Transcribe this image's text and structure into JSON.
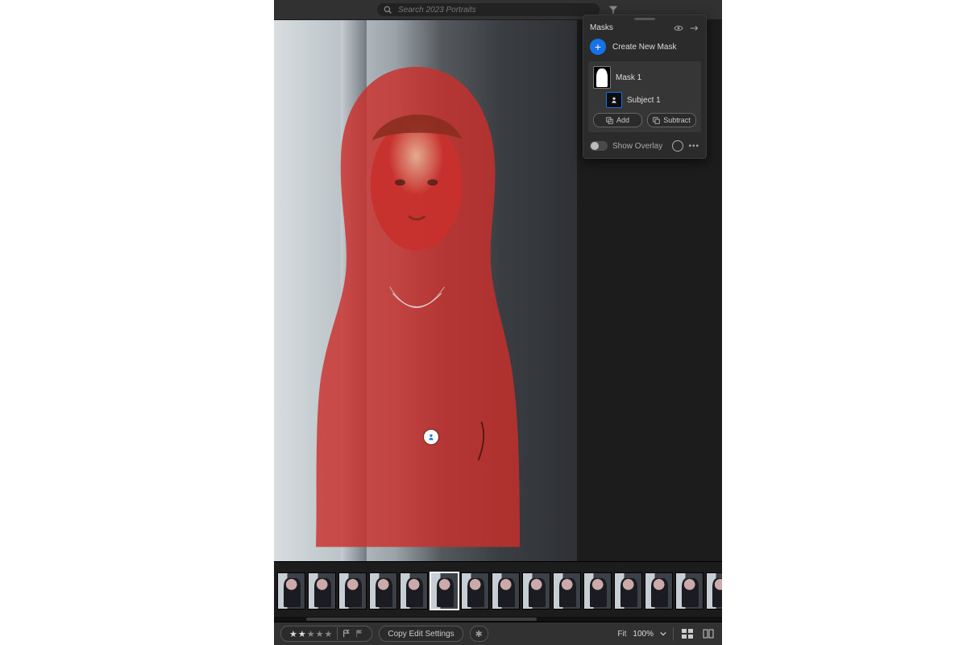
{
  "colors": {
    "accent": "#1473e6",
    "overlay": "#c9302c"
  },
  "search": {
    "placeholder": "Search 2023 Portraits"
  },
  "masks_panel": {
    "title": "Masks",
    "create_label": "Create New Mask",
    "mask_name": "Mask 1",
    "subject_name": "Subject 1",
    "add_label": "Add",
    "subtract_label": "Subtract",
    "overlay_label": "Show Overlay"
  },
  "filmstrip": {
    "count": 15,
    "selected_index": 5
  },
  "bottom": {
    "rating": 2,
    "copy_label": "Copy Edit Settings",
    "fit_label": "Fit",
    "zoom": "100%"
  }
}
